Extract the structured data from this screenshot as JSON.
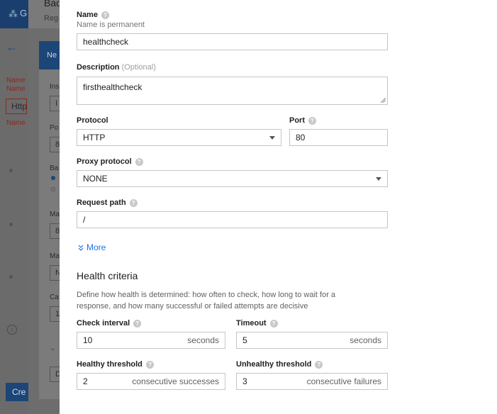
{
  "background": {
    "app_logo_text": "G",
    "title_fragment": "Bac",
    "subtitle_fragment": "Reg",
    "name_label": "Name",
    "name_label2": "Name",
    "name_value": "Http",
    "name_error": "Name",
    "panel_header": "Ne",
    "panel_labels": [
      "Ins",
      "Po",
      "Ba",
      "Ma",
      "Ma",
      "Ca"
    ],
    "panel_values": [
      "I",
      "8",
      "8",
      "N",
      "1",
      "D"
    ],
    "create_button": "Cre"
  },
  "dialog": {
    "name": {
      "label": "Name",
      "hint": "Name is permanent",
      "value": "healthcheck"
    },
    "description": {
      "label": "Description",
      "optional": "(Optional)",
      "value": "firsthealthcheck"
    },
    "protocol": {
      "label": "Protocol",
      "value": "HTTP"
    },
    "port": {
      "label": "Port",
      "value": "80"
    },
    "proxy_protocol": {
      "label": "Proxy protocol",
      "value": "NONE"
    },
    "request_path": {
      "label": "Request path",
      "value": "/"
    },
    "more_link": "More",
    "health_criteria": {
      "heading": "Health criteria",
      "description_line1": "Define how health is determined: how often to check, how long to wait for a",
      "description_line2": "response, and how many successful or failed attempts are decisive"
    },
    "check_interval": {
      "label": "Check interval",
      "value": "10",
      "unit": "seconds"
    },
    "timeout": {
      "label": "Timeout",
      "value": "5",
      "unit": "seconds"
    },
    "healthy_threshold": {
      "label": "Healthy threshold",
      "value": "2",
      "unit": "consecutive successes"
    },
    "unhealthy_threshold": {
      "label": "Unhealthy threshold",
      "value": "3",
      "unit": "consecutive failures"
    },
    "icons": {
      "help": "help-icon",
      "dropdown": "chevron-down-icon",
      "more": "double-chevron-down-icon"
    },
    "colors": {
      "link": "#1a73e8",
      "field_border": "#c6c6c6",
      "help_icon": "#c8c8c8"
    }
  }
}
